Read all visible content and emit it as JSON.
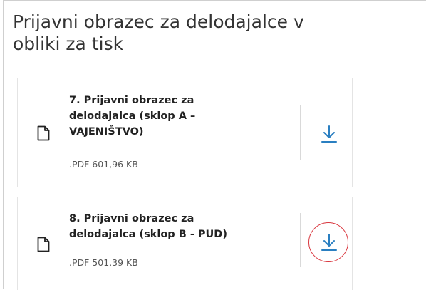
{
  "section": {
    "title": "Prijavni obrazec za delodajalce v obliki za tisk"
  },
  "documents": [
    {
      "title": "7. Prijavni obrazec za delodajalca (sklop A – VAJENIŠTVO)",
      "meta": ".PDF 601,96 KB",
      "icon": "document-icon",
      "action_icon": "download-icon",
      "highlighted": false
    },
    {
      "title": "8. Prijavni obrazec za delodajalca (sklop B - PUD)",
      "meta": ".PDF 501,39 KB",
      "icon": "document-icon",
      "action_icon": "download-icon",
      "highlighted": true
    }
  ],
  "colors": {
    "accent": "#2a7fc1",
    "highlight": "#d9363e",
    "text": "#222222",
    "muted": "#555555",
    "border": "#e4e4e4"
  }
}
